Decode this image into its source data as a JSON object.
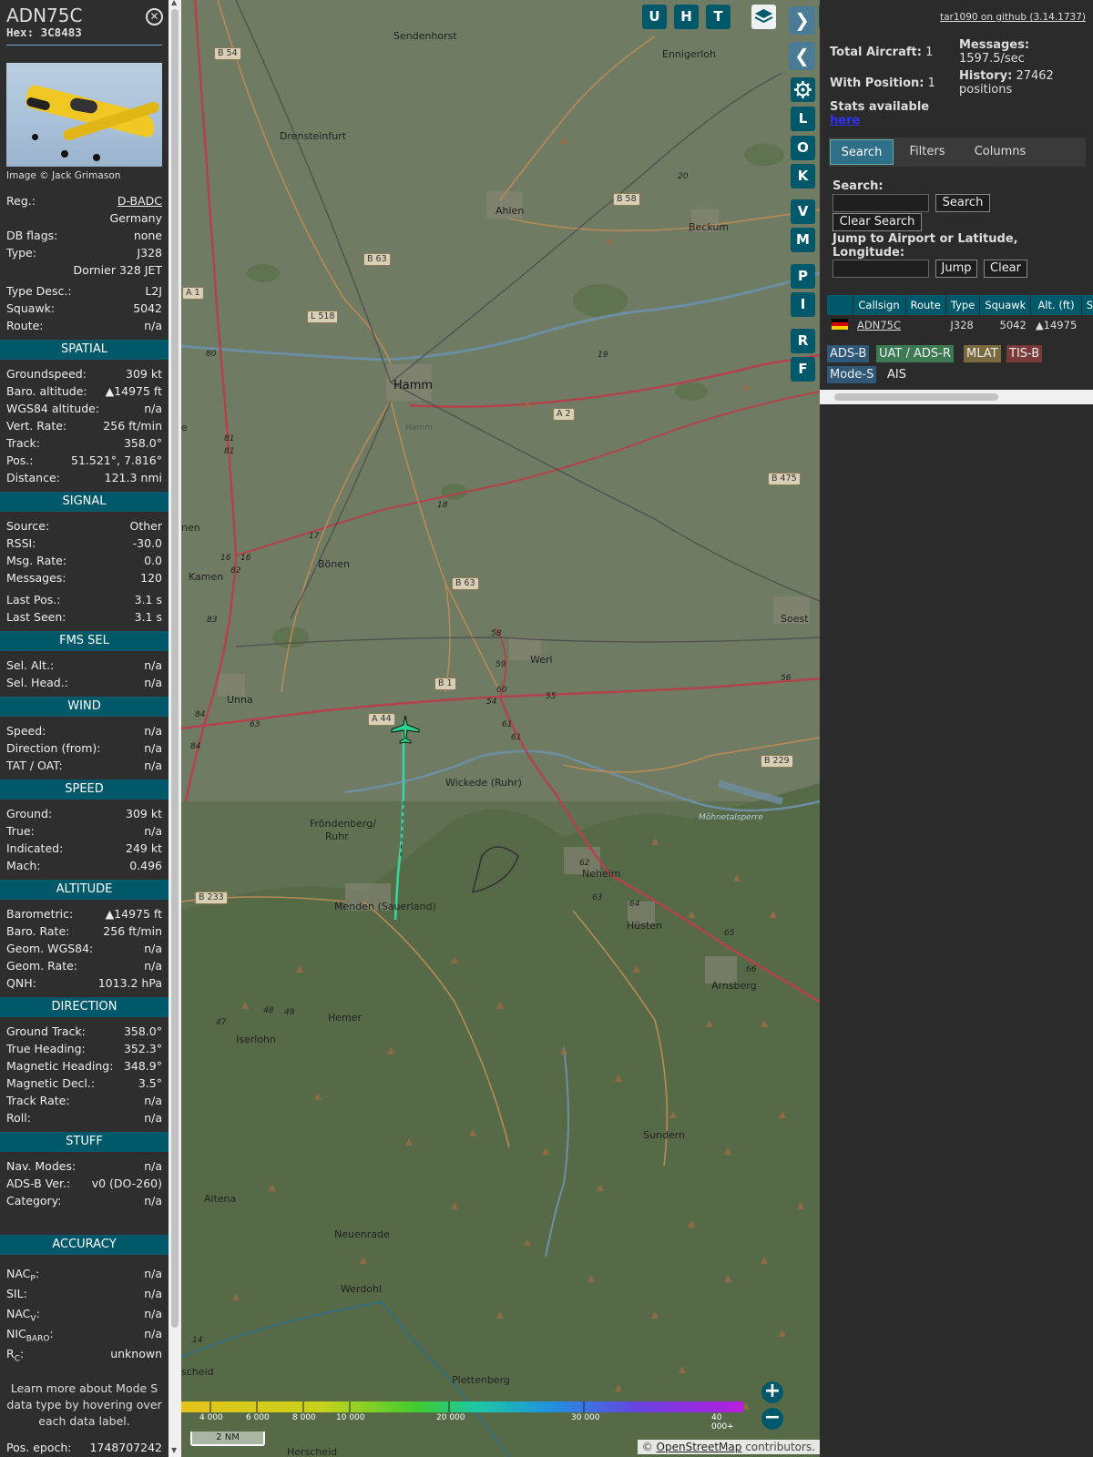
{
  "aircraft": {
    "callsign": "ADN75C",
    "hex": "Hex: 3C8483",
    "close_symbol": "✕",
    "photo_credit": "Image © Jack Grimason",
    "reg_label": "Reg.:",
    "reg": "D-BADC",
    "country": "Germany",
    "dbflags_label": "DB flags:",
    "dbflags": "none",
    "type_label": "Type:",
    "type": "J328",
    "type_name": "Dornier 328 JET",
    "typedesc_label": "Type Desc.:",
    "typedesc": "L2J",
    "squawk_label": "Squawk:",
    "squawk": "5042",
    "route_label": "Route:",
    "route": "n/a"
  },
  "sections": {
    "spatial": "SPATIAL",
    "signal": "SIGNAL",
    "fms": "FMS SEL",
    "wind": "WIND",
    "speed": "SPEED",
    "altitude": "ALTITUDE",
    "direction": "DIRECTION",
    "stuff": "STUFF",
    "accuracy": "ACCURACY"
  },
  "spatial": [
    {
      "k": "Groundspeed:",
      "v": "309 kt"
    },
    {
      "k": "Baro. altitude:",
      "v": "▲14975 ft"
    },
    {
      "k": "WGS84 altitude:",
      "v": "n/a"
    },
    {
      "k": "Vert. Rate:",
      "v": "256 ft/min"
    },
    {
      "k": "Track:",
      "v": "358.0°"
    },
    {
      "k": "Pos.:",
      "v": "51.521°, 7.816°"
    },
    {
      "k": "Distance:",
      "v": "121.3 nmi"
    }
  ],
  "signal": [
    {
      "k": "Source:",
      "v": "Other"
    },
    {
      "k": "RSSI:",
      "v": "-30.0"
    },
    {
      "k": "Msg. Rate:",
      "v": "0.0"
    },
    {
      "k": "Messages:",
      "v": "120"
    },
    {
      "k": "Last Pos.:",
      "v": "3.1 s"
    },
    {
      "k": "Last Seen:",
      "v": "3.1 s"
    }
  ],
  "fms": [
    {
      "k": "Sel. Alt.:",
      "v": "n/a"
    },
    {
      "k": "Sel. Head.:",
      "v": "n/a"
    }
  ],
  "wind": [
    {
      "k": "Speed:",
      "v": "n/a"
    },
    {
      "k": "Direction (from):",
      "v": "n/a"
    },
    {
      "k": "TAT / OAT:",
      "v": "n/a"
    }
  ],
  "speed": [
    {
      "k": "Ground:",
      "v": "309 kt"
    },
    {
      "k": "True:",
      "v": "n/a"
    },
    {
      "k": "Indicated:",
      "v": "249 kt"
    },
    {
      "k": "Mach:",
      "v": "0.496"
    }
  ],
  "altitude": [
    {
      "k": "Barometric:",
      "v": "▲14975 ft"
    },
    {
      "k": "Baro. Rate:",
      "v": "256 ft/min"
    },
    {
      "k": "Geom. WGS84:",
      "v": "n/a"
    },
    {
      "k": "Geom. Rate:",
      "v": "n/a"
    },
    {
      "k": "QNH:",
      "v": "1013.2 hPa"
    }
  ],
  "direction": [
    {
      "k": "Ground Track:",
      "v": "358.0°"
    },
    {
      "k": "True Heading:",
      "v": "352.3°"
    },
    {
      "k": "Magnetic Heading:",
      "v": "348.9°"
    },
    {
      "k": "Magnetic Decl.:",
      "v": "3.5°"
    },
    {
      "k": "Track Rate:",
      "v": "n/a"
    },
    {
      "k": "Roll:",
      "v": "n/a"
    }
  ],
  "stuff": [
    {
      "k": "Nav. Modes:",
      "v": "n/a"
    },
    {
      "k": "ADS-B Ver.:",
      "v": "v0 (DO-260)"
    },
    {
      "k": "Category:",
      "v": "n/a"
    }
  ],
  "accuracy": {
    "nacp_k": "NAC",
    "nacp_sub": "P",
    "nacp_v": "n/a",
    "sil_k": "SIL:",
    "sil_v": "n/a",
    "nacv_k": "NAC",
    "nacv_sub": "V",
    "nacv_v": "n/a",
    "nic_k": "NIC",
    "nic_sub": "BARO",
    "nic_v": "n/a",
    "rc_k": "R",
    "rc_sub": "C",
    "rc_v": "unknown"
  },
  "note": "Learn more about Mode S data type by hovering over each data label.",
  "epoch_label": "Pos. epoch:",
  "epoch": "1748707242",
  "map": {
    "buttons_top": [
      "U",
      "H",
      "T"
    ],
    "buttons_side": [
      "L",
      "O",
      "K",
      "V",
      "M",
      "P",
      "I",
      "R",
      "F"
    ],
    "arrow_right": "❯",
    "arrow_left": "❮",
    "expand": "◂▸",
    "zoom_in": "+",
    "zoom_out": "−",
    "scale": "2 NM",
    "attribution_prefix": "© ",
    "attribution_link": "OpenStreetMap",
    "attribution_suffix": " contributors.",
    "alt_labels": [
      "4 000",
      "6 000",
      "8 000",
      "10 000",
      "20 000",
      "30 000",
      "40 000+"
    ],
    "towns": {
      "sendenhorst": "Sendenhorst",
      "ennigerloh": "Ennigerloh",
      "drensteinfurt": "Drensteinfurt",
      "ahlen": "Ahlen",
      "beckum": "Beckum",
      "hamm": "Hamm",
      "hamm2": "Hamm",
      "bonen": "Bönen",
      "kamen": "Kamen",
      "soest": "Soest",
      "werl": "Werl",
      "unna": "Unna",
      "wickede": "Wickede (Ruhr)",
      "frondenberg": "Fröndenberg/",
      "ruhr": "Ruhr",
      "neheim": "Neheim",
      "menden": "Menden (Sauerland)",
      "husten": "Hüsten",
      "arnsberg": "Arnsberg",
      "hemer": "Hemer",
      "iserlohn": "Iserlohn",
      "sundern": "Sundern",
      "altena": "Altena",
      "neuenrade": "Neuenrade",
      "werdohl": "Werdohl",
      "plettenberg": "Plettenberg",
      "herscheid": "Herscheid",
      "scheid": "scheid",
      "mohne": "Möhnetalsperre",
      "nen": "nen",
      "e": "e"
    },
    "roads": {
      "b54": "B 54",
      "b58": "B 58",
      "b63a": "B 63",
      "a1": "A 1",
      "l518": "L 518",
      "a2": "A 2",
      "b475": "B 475",
      "b63b": "B 63",
      "b1": "B 1",
      "a44": "A 44",
      "b229": "B 229",
      "b233": "B 233"
    },
    "exits": {
      "e20": "20",
      "e19": "19",
      "e80": "80",
      "e81": "81",
      "e81b": "81",
      "e18": "18",
      "e17": "17",
      "e16": "16",
      "e16b": "16",
      "e82": "82",
      "e83": "83",
      "e58": "58",
      "e59": "59",
      "e60": "60",
      "e54": "54",
      "e55": "55",
      "e56": "56",
      "e61": "61",
      "e61b": "61",
      "e84": "84",
      "e84b": "84",
      "e63": "63",
      "e62": "62",
      "e63b": "63",
      "e64": "64",
      "e65": "65",
      "e66": "66",
      "e48": "48",
      "e49": "49",
      "e47": "47",
      "e14": "14"
    }
  },
  "right": {
    "github": "tar1090 on github (3.14.1737)",
    "total_label": "Total Aircraft:",
    "total": "1",
    "messages_label": "Messages:",
    "messages": "1597.5/sec",
    "withpos_label": "With Position:",
    "withpos": "1",
    "history_label": "History:",
    "history": "27462",
    "history_unit": "positions",
    "stats_label": "Stats available",
    "stats_link": "here",
    "tabs": [
      "Search",
      "Filters",
      "Columns"
    ],
    "search_label": "Search:",
    "search_btn": "Search",
    "clear_search_btn": "Clear Search",
    "jump_label": "Jump to Airport or Latitude, Longitude:",
    "jump_btn": "Jump",
    "clear_btn": "Clear",
    "table": {
      "headers": [
        "",
        "Callsign",
        "Route",
        "Type",
        "Squawk",
        "Alt. (ft)",
        "Spd"
      ],
      "row": {
        "callsign": "ADN75C",
        "route": "",
        "type": "J328",
        "squawk": "5042",
        "alt": "▲14975"
      }
    },
    "legend": [
      "ADS-B",
      "UAT / ADS-R",
      "MLAT",
      "TIS-B",
      "Mode-S",
      "AIS"
    ],
    "colors": {
      "adsb": "#2e5778",
      "uat": "#3d7a53",
      "mlat": "#7a6a3d",
      "tisb": "#7a3a3a",
      "modes": "#2e5778"
    }
  }
}
